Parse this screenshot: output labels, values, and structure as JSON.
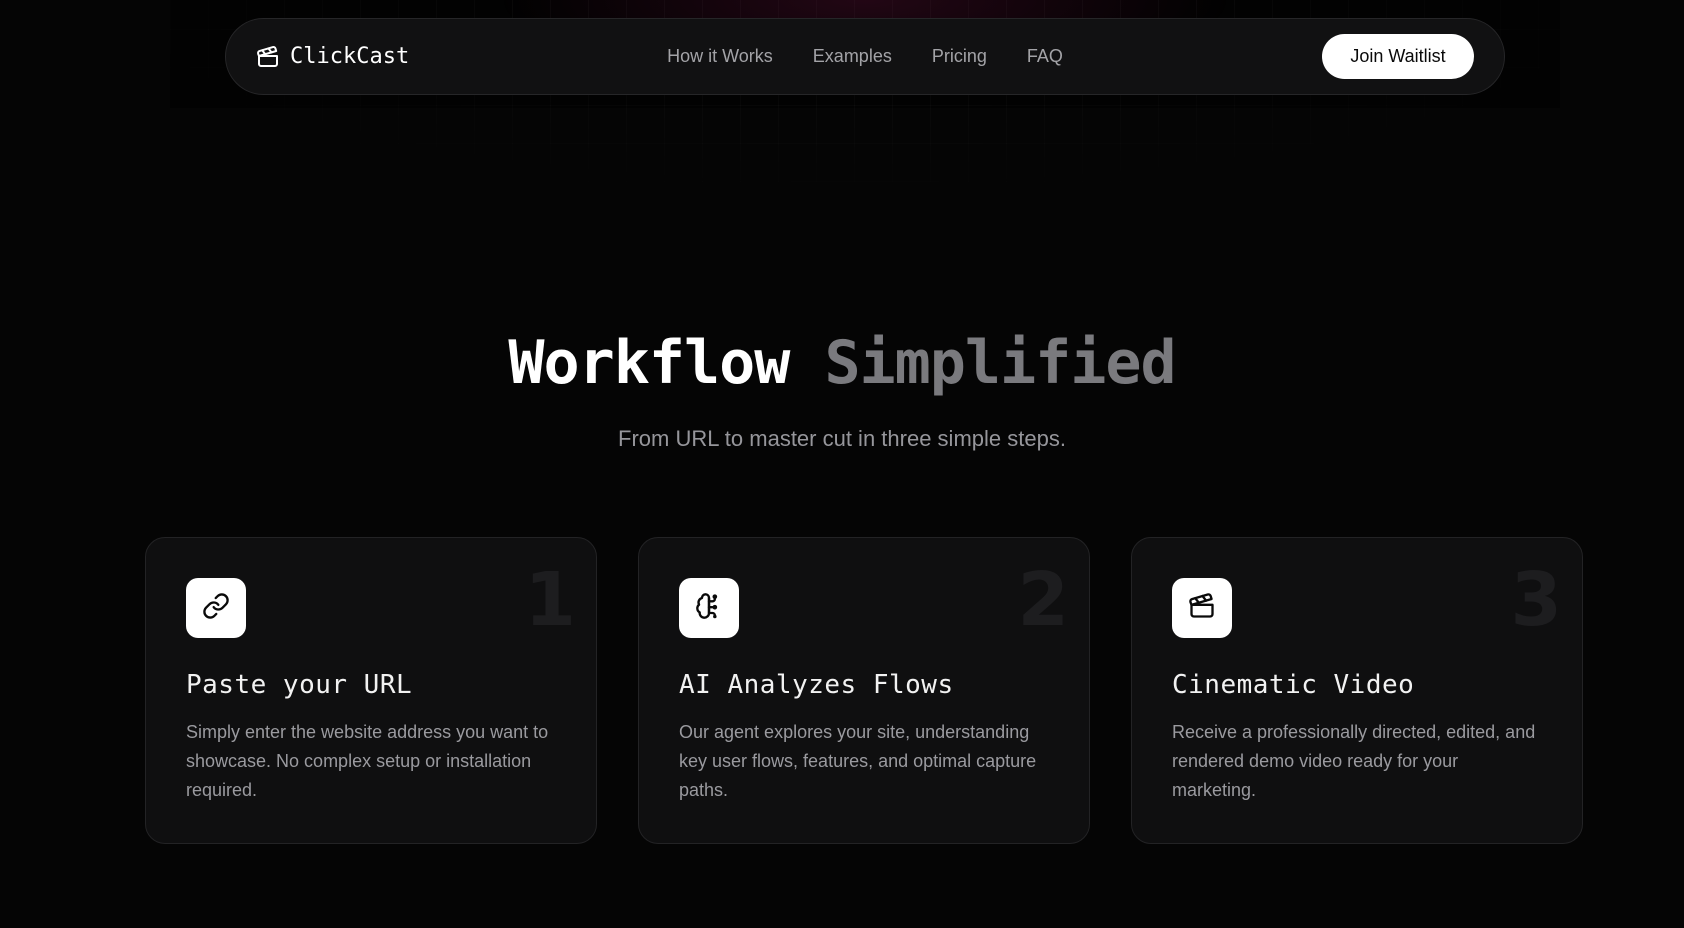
{
  "brand": {
    "name": "ClickCast",
    "icon": "clapperboard-icon"
  },
  "nav": {
    "links": [
      {
        "label": "How it Works"
      },
      {
        "label": "Examples"
      },
      {
        "label": "Pricing"
      },
      {
        "label": "FAQ"
      }
    ],
    "cta_label": "Join Waitlist"
  },
  "section": {
    "title_part1": "Workflow",
    "title_part2": "Simplified",
    "subtitle": "From URL to master cut in three simple steps."
  },
  "steps": [
    {
      "number": "1",
      "icon": "link-icon",
      "title": "Paste your URL",
      "description": "Simply enter the website address you want to showcase. No complex setup or installation required."
    },
    {
      "number": "2",
      "icon": "brain-icon",
      "title": "AI Analyzes Flows",
      "description": "Our agent explores your site, understanding key user flows, features, and optimal capture paths."
    },
    {
      "number": "3",
      "icon": "clapperboard-icon",
      "title": "Cinematic Video",
      "description": "Receive a professionally directed, edited, and rendered demo video ready for your marketing."
    }
  ],
  "colors": {
    "background": "#050505",
    "card": "#0f0f10",
    "accent_white": "#ffffff",
    "muted_text": "#9a9a9f"
  }
}
